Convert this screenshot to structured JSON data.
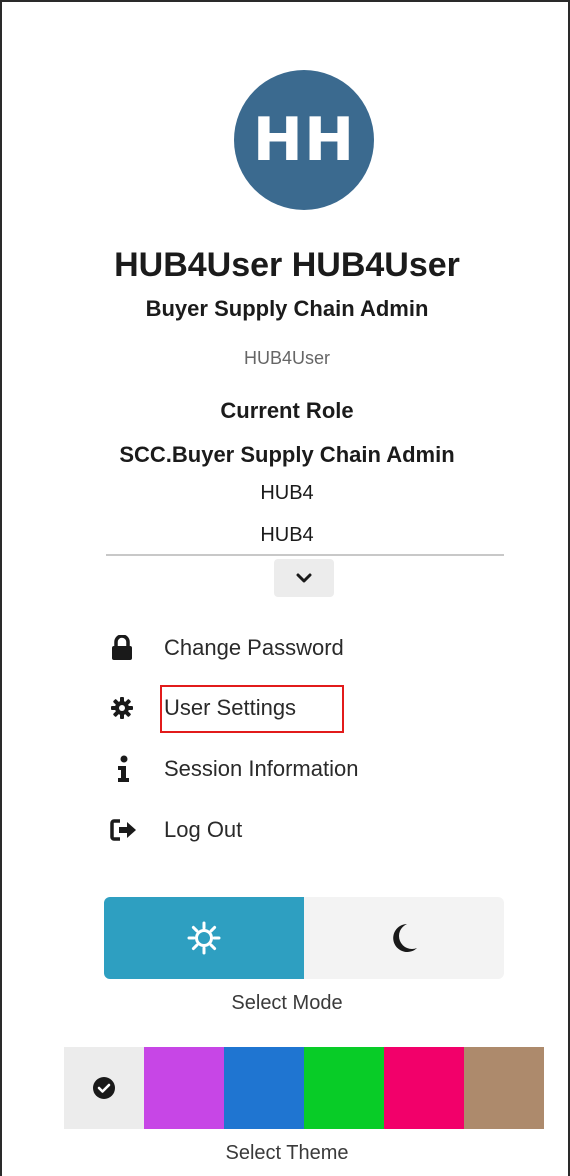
{
  "user": {
    "initials": "HH",
    "full_name": "HUB4User HUB4User",
    "job_title": "Buyer Supply Chain Admin",
    "username": "HUB4User",
    "current_role_label": "Current Role",
    "current_role": "SCC.Buyer Supply Chain Admin",
    "org_line_1": "HUB4",
    "org_line_2": "HUB4"
  },
  "menu": {
    "items": [
      {
        "label": "Change Password",
        "icon": "lock-icon"
      },
      {
        "label": "User Settings",
        "icon": "gear-icon"
      },
      {
        "label": "Session Information",
        "icon": "info-icon"
      },
      {
        "label": "Log Out",
        "icon": "sign-out-icon"
      }
    ]
  },
  "mode": {
    "caption": "Select Mode",
    "options": [
      {
        "name": "light",
        "icon": "sun-icon",
        "selected": true
      },
      {
        "name": "dark",
        "icon": "moon-icon",
        "selected": false
      }
    ]
  },
  "theme": {
    "caption": "Select Theme",
    "swatches": [
      {
        "color": "#ececec",
        "selected": true
      },
      {
        "color": "#c746e6"
      },
      {
        "color": "#1f75d1"
      },
      {
        "color": "#08cc27"
      },
      {
        "color": "#f2006a"
      },
      {
        "color": "#ad8a6c"
      }
    ]
  },
  "colors": {
    "avatar_bg": "#3b6a8f",
    "mode_active": "#2e9fc1",
    "highlight_box": "#e21b1b"
  }
}
